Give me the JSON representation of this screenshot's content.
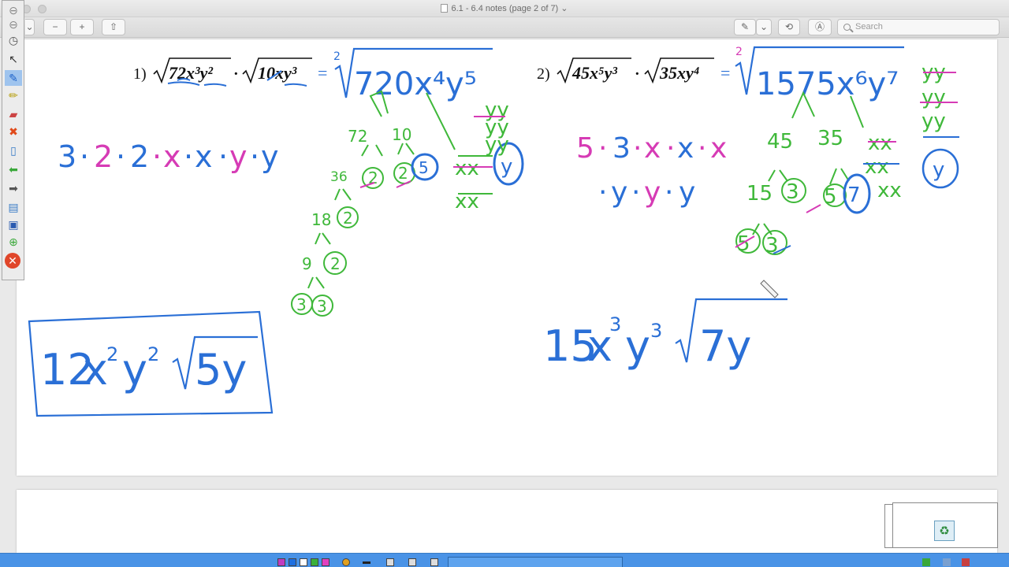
{
  "window": {
    "title": "6.1 - 6.4 notes (page 2 of 7)",
    "title_chevron": "⌄"
  },
  "toolbar": {
    "zoom_out_icon": "−",
    "zoom_in_icon": "+",
    "share_icon": "⇧",
    "markup_icon": "✎",
    "dropdown_icon": "⌄",
    "rotate_icon": "⟲",
    "annotate_icon": "Ⓐ",
    "search_placeholder": "Search"
  },
  "problem1": {
    "number": "1)",
    "expr_a": "72x³y²",
    "dot": "·",
    "expr_b": "10xy³",
    "equals": "=",
    "index": "2",
    "radicand": "720x⁴y⁵",
    "tree": [
      "72",
      "10",
      "36",
      "2",
      "2",
      "5",
      "18",
      "2",
      "9",
      "2",
      "3",
      "3"
    ],
    "var_tree": [
      "yy",
      "yy",
      "yy",
      "xx",
      "xx",
      "y"
    ],
    "factor_seq": [
      "3",
      "·",
      "2",
      "·",
      "2",
      "·",
      "x",
      "·",
      "x",
      "·",
      "y",
      "·",
      "y"
    ],
    "answer": {
      "coef": "12",
      "x": "x",
      "xexp": "2",
      "y": "y",
      "yexp": "2",
      "rad": "5y"
    }
  },
  "problem2": {
    "number": "2)",
    "expr_a": "45x⁵y³",
    "dot": "·",
    "expr_b": "35xy⁴",
    "equals": "=",
    "index": "2",
    "radicand": "1575x⁶y⁷",
    "tree": [
      "45",
      "35",
      "15",
      "3",
      "5",
      "7",
      "5",
      "3"
    ],
    "var_tree": [
      "yy",
      "yy",
      "yy",
      "xx",
      "xx",
      "xx",
      "y"
    ],
    "factor_seq_1": [
      "5",
      "·",
      "3",
      "·",
      "x",
      "·",
      "x",
      "·",
      "x"
    ],
    "factor_seq_2": [
      "·",
      "y",
      "·",
      "y",
      "·",
      "y"
    ],
    "answer": {
      "coef": "15",
      "x": "x",
      "xexp": "3",
      "y": "y",
      "yexp": "3",
      "rad": "7y"
    }
  },
  "colors": {
    "ink_blue": "#2a6fd6",
    "ink_green": "#3fb83a",
    "ink_magenta": "#d63bb5",
    "taskbar": "#4a93e6"
  },
  "side_tools": [
    "pointer-icon",
    "pen-icon",
    "highlighter-icon",
    "eraser-icon",
    "clear-icon",
    "page-icon",
    "back-arrow-icon",
    "forward-arrow-icon",
    "keyboard-icon",
    "save-icon",
    "lock-icon",
    "close-icon"
  ],
  "taskbar_swatches": [
    "#c03cc0",
    "#1e6fe0",
    "#ffffff",
    "#3ab03a",
    "#e040c0",
    "#e0a020"
  ]
}
